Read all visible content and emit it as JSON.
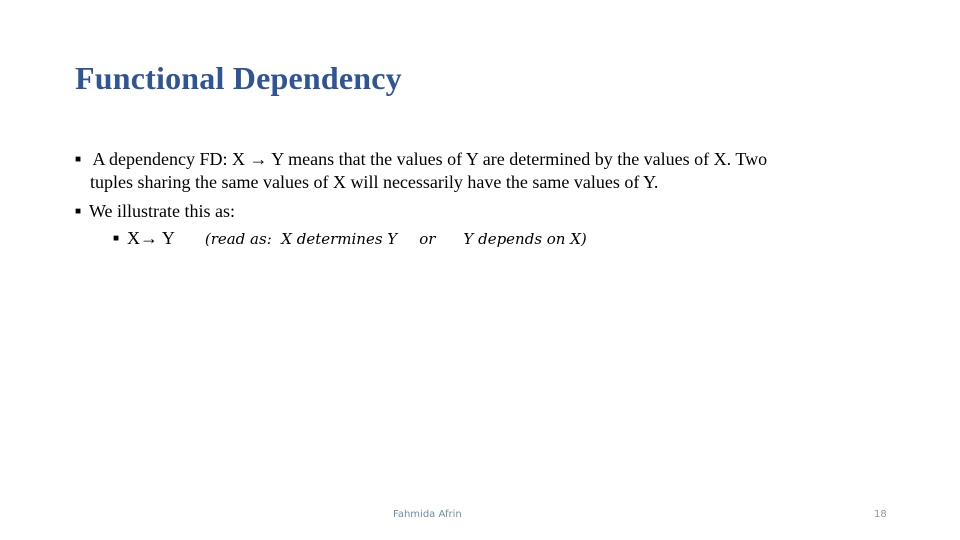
{
  "slide": {
    "title": "Functional Dependency",
    "bullets": [
      {
        "marker": "§",
        "line1": " A dependency FD: X → Y means that the values of Y are determined by the values of X. Two",
        "line2": "tuples sharing the same values of X will necessarily have the same values of Y."
      },
      {
        "marker": "§",
        "text": "We illustrate this as:",
        "sub": {
          "marker": "§",
          "expr": "X→ Y",
          "reading_prefix": "(read as:  X determines Y",
          "or": "or",
          "reading_suffix": "Y depends on X)"
        }
      }
    ],
    "footer": {
      "author": "Fahmida Afrin",
      "page_number": "18"
    }
  }
}
